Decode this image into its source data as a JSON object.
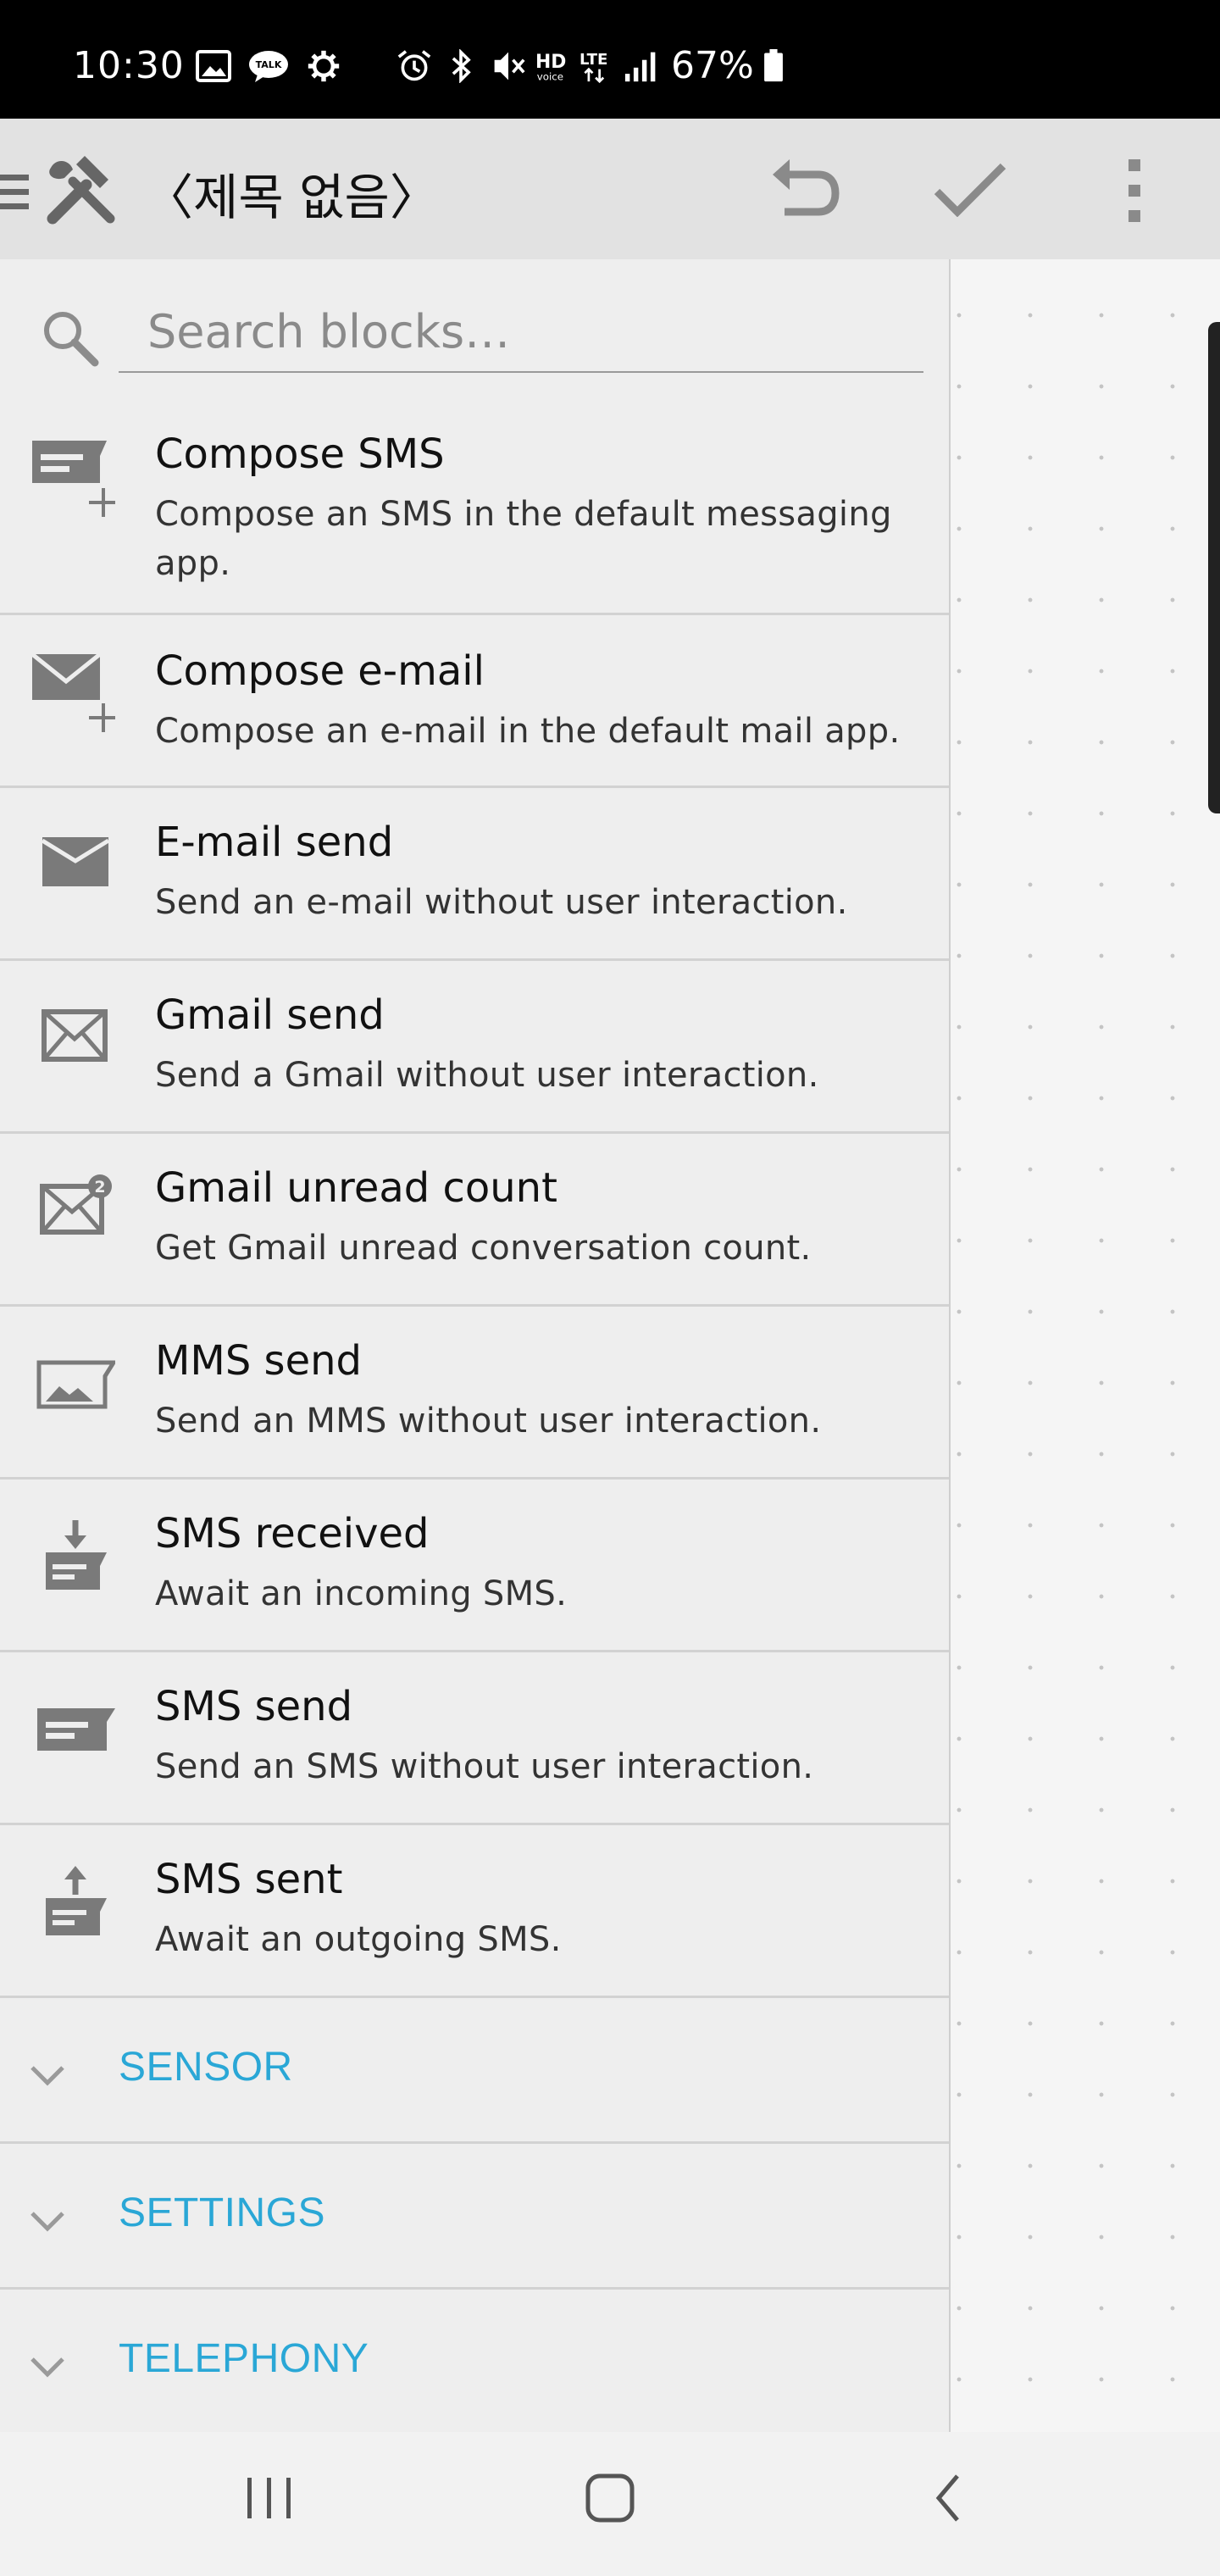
{
  "status_bar": {
    "time": "10:30",
    "battery": "67%",
    "network": "LTE",
    "icons": [
      "gallery-icon",
      "kakaotalk-icon",
      "settings-gear-icon",
      "alarm-icon",
      "bluetooth-icon",
      "vibrate-mute-icon",
      "hd-voice-icon",
      "lte-icon",
      "signal-icon",
      "battery-icon"
    ]
  },
  "app_bar": {
    "title": "〈제목 없음〉",
    "icons": [
      "menu-icon",
      "tools-icon",
      "undo-icon",
      "check-icon",
      "more-vert-icon"
    ]
  },
  "search": {
    "placeholder": "Search blocks…",
    "value": ""
  },
  "blocks": [
    {
      "title": "Compose SMS",
      "description": "Compose an SMS in the default messaging app.",
      "icon": "compose-sms-icon"
    },
    {
      "title": "Compose e-mail",
      "description": "Compose an e-mail in the default mail app.",
      "icon": "compose-email-icon"
    },
    {
      "title": "E-mail send",
      "description": "Send an e-mail without user interaction.",
      "icon": "email-icon"
    },
    {
      "title": "Gmail send",
      "description": "Send a Gmail without user interaction.",
      "icon": "gmail-icon"
    },
    {
      "title": "Gmail unread count",
      "description": "Get Gmail unread conversation count.",
      "icon": "gmail-unread-icon"
    },
    {
      "title": "MMS send",
      "description": "Send an MMS without user interaction.",
      "icon": "mms-icon"
    },
    {
      "title": "SMS received",
      "description": "Await an incoming SMS.",
      "icon": "sms-received-icon"
    },
    {
      "title": "SMS send",
      "description": "Send an SMS without user interaction.",
      "icon": "sms-send-icon"
    },
    {
      "title": "SMS sent",
      "description": "Await an outgoing SMS.",
      "icon": "sms-sent-icon"
    }
  ],
  "categories": [
    {
      "label": "SENSOR"
    },
    {
      "label": "SETTINGS"
    },
    {
      "label": "TELEPHONY"
    }
  ],
  "colors": {
    "accent": "#2aa7d6",
    "icon": "#7a7a7a",
    "drawer_bg": "#eeeeee",
    "status_bar": "#000000"
  },
  "nav_bar": {
    "icons": [
      "recent-apps-icon",
      "home-icon",
      "back-icon"
    ]
  }
}
